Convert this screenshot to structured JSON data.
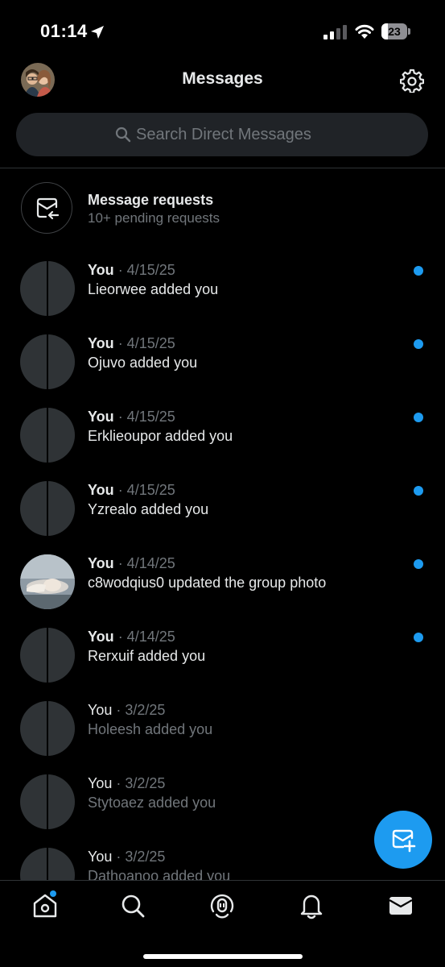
{
  "status_bar": {
    "time": "01:14",
    "battery": "23"
  },
  "header": {
    "title": "Messages"
  },
  "search": {
    "placeholder": "Search Direct Messages"
  },
  "requests": {
    "title": "Message requests",
    "subtitle": "10+ pending requests"
  },
  "conversations": [
    {
      "sender": "You",
      "date": "· 4/15/25",
      "preview": "Lieorwee added you",
      "unread": true
    },
    {
      "sender": "You",
      "date": "· 4/15/25",
      "preview": "Ojuvo added you",
      "unread": true
    },
    {
      "sender": "You",
      "date": "· 4/15/25",
      "preview": "Erklieoupor added you",
      "unread": true
    },
    {
      "sender": "You",
      "date": "· 4/15/25",
      "preview": "Yzrealo added you",
      "unread": true
    },
    {
      "sender": "You",
      "date": "· 4/14/25",
      "preview": "c8wodqius0 updated the group photo",
      "unread": true
    },
    {
      "sender": "You",
      "date": "· 4/14/25",
      "preview": "Rerxuif added you",
      "unread": true
    },
    {
      "sender": "You",
      "date": "· 3/2/25",
      "preview": "Holeesh added you",
      "unread": false
    },
    {
      "sender": "You",
      "date": "· 3/2/25",
      "preview": "Stytoaez added you",
      "unread": false
    },
    {
      "sender": "You",
      "date": "· 3/2/25",
      "preview": "Dathoanoo added you",
      "unread": false
    }
  ],
  "tab_bar": {
    "tabs": [
      "home-icon",
      "search-icon",
      "spaces-icon",
      "notifications-icon",
      "messages-icon"
    ],
    "active": "messages-icon"
  },
  "colors": {
    "accent": "#1d9bf0",
    "background": "#000000",
    "secondary_text": "#71767b"
  }
}
